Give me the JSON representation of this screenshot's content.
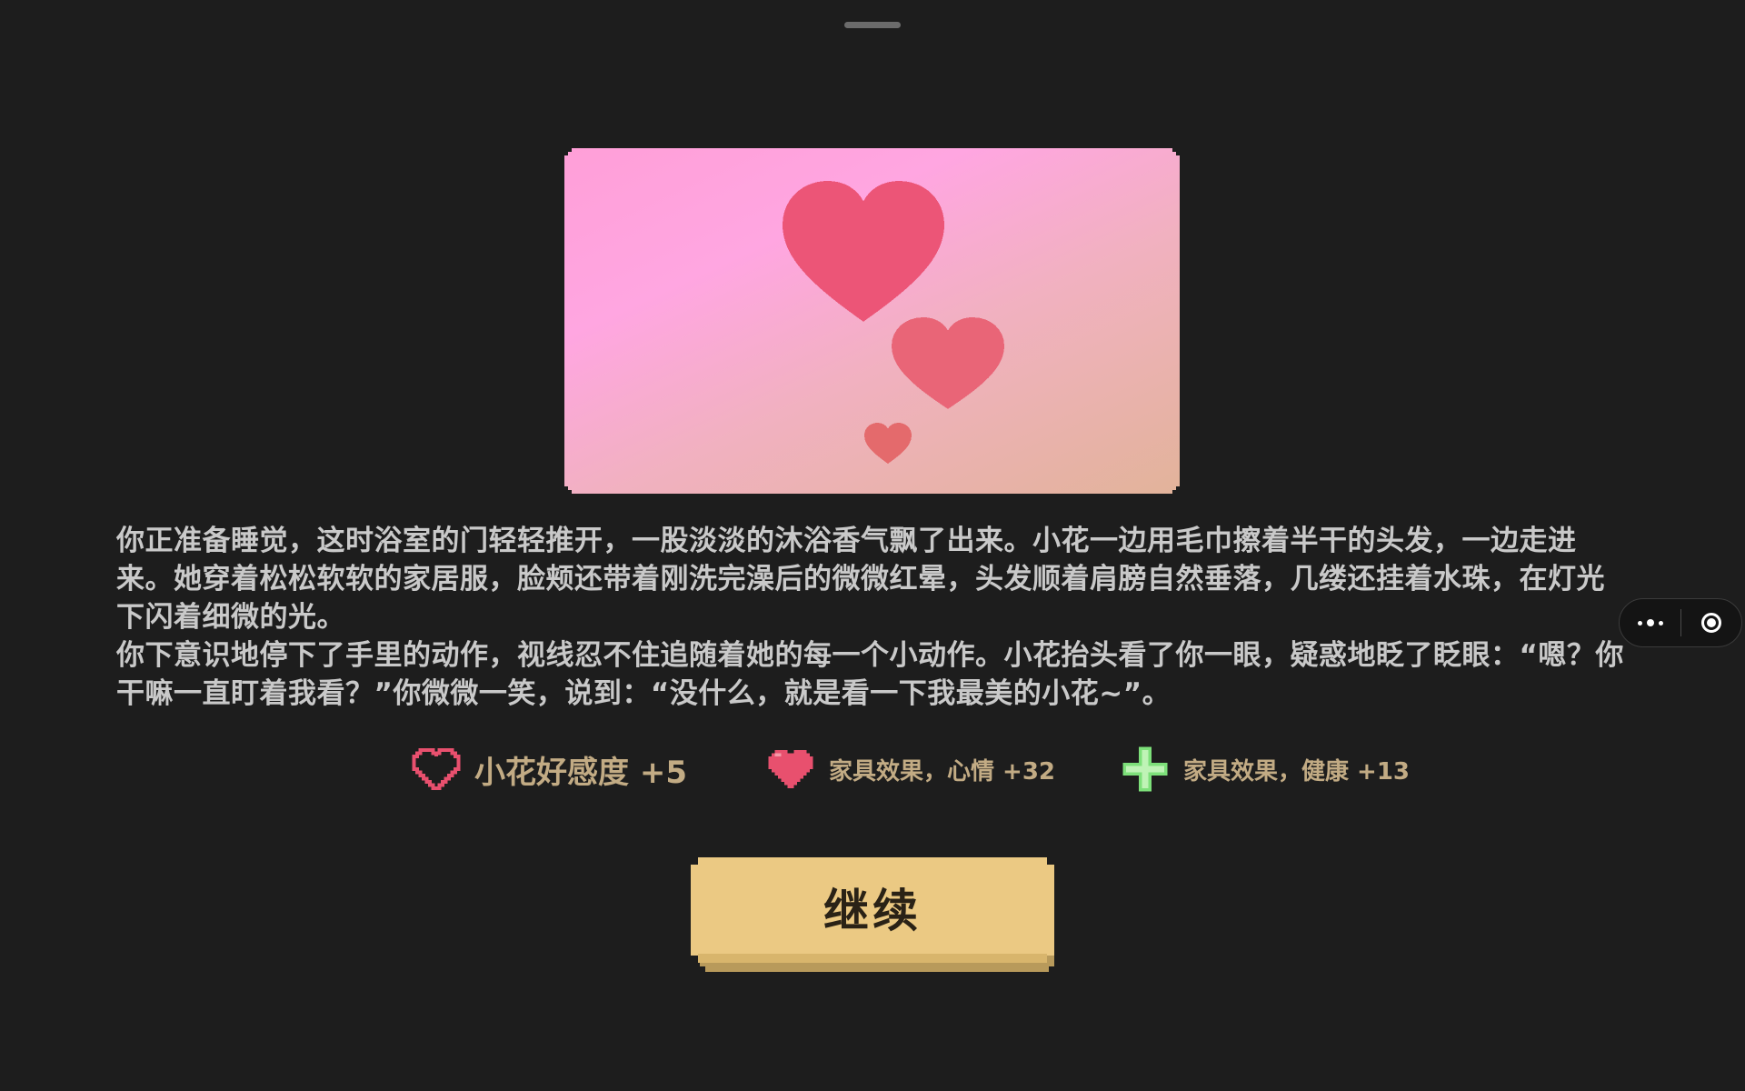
{
  "story": {
    "paragraph_1": "你正准备睡觉，这时浴室的门轻轻推开，一股淡淡的沐浴香气飘了出来。小花一边用毛巾擦着半干的头发，一边走进来。她穿着松松软软的家居服，脸颊还带着刚洗完澡后的微微红晕，头发顺着肩膀自然垂落，几缕还挂着水珠，在灯光下闪着细微的光。",
    "paragraph_2": "你下意识地停下了手里的动作，视线忍不住追随着她的每一个小动作。小花抬头看了你一眼，疑惑地眨了眨眼：“嗯？你干嘛一直盯着我看？”你微微一笑，说到：“没什么，就是看一下我最美的小花~”。"
  },
  "rewards": [
    {
      "icon": "heart-outline-icon",
      "text": "小花好感度 +5"
    },
    {
      "icon": "heart-filled-icon",
      "text": "家具效果，心情 +32"
    },
    {
      "icon": "green-cross-icon",
      "text": "家具效果，健康 +13"
    }
  ],
  "continue_button": {
    "label": "继续"
  },
  "colors": {
    "background": "#1d1d1d",
    "story_text": "#c9c9c9",
    "reward_text": "#c2ab84",
    "button_face": "#ebc983",
    "heart_red": "#e8506e",
    "health_green": "#7de07a"
  }
}
